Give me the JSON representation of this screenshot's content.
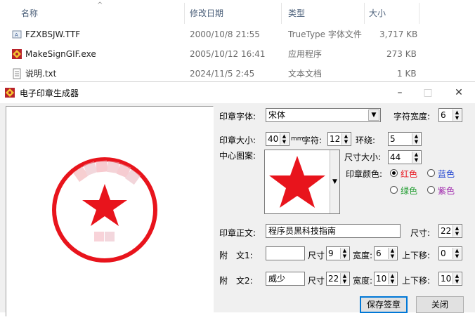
{
  "explorer": {
    "columns": {
      "name": "名称",
      "date": "修改日期",
      "type": "类型",
      "size": "大小"
    },
    "files": [
      {
        "name": "FZXBSJW.TTF",
        "date": "2000/10/8 21:55",
        "type": "TrueType 字体文件",
        "size": "3,717 KB",
        "icon": "font-file-icon"
      },
      {
        "name": "MakeSignGIF.exe",
        "date": "2005/10/12 16:41",
        "type": "应用程序",
        "size": "273 KB",
        "icon": "app-exe-icon"
      },
      {
        "name": "说明.txt",
        "date": "2024/11/5 2:45",
        "type": "文本文档",
        "size": "1 KB",
        "icon": "text-file-icon"
      }
    ]
  },
  "dialog": {
    "title": "电子印章生成器",
    "font_label": "印章字体:",
    "font_value": "宋体",
    "char_width_label": "字符宽度:",
    "char_width_value": "6",
    "size_label": "印章大小:",
    "size_value": "40",
    "mm_unit": "mm",
    "char_label": "字符:",
    "char_value": "12",
    "ring_label": "环绕:",
    "ring_value": "5",
    "center_label": "中心图案:",
    "center_size_label": "尺寸大小:",
    "center_size_value": "44",
    "color_label": "印章颜色:",
    "colors": {
      "red": "红色",
      "blue": "蓝色",
      "green": "绿色",
      "purple": "紫色"
    },
    "body_label": "印章正文:",
    "body_value": "程序员黑科技指南",
    "body_size_label": "尺寸:",
    "body_size_value": "22",
    "aux1_label": "附　文1:",
    "aux1_value": "",
    "aux1_size_label": "尺寸",
    "aux1_size_value": "9",
    "aux1_width_label": "宽度:",
    "aux1_width_value": "6",
    "aux1_shift_label": "上下移:",
    "aux1_shift_value": "0",
    "aux2_label": "附　文2:",
    "aux2_value": "威少",
    "aux2_size_label": "尺寸",
    "aux2_size_value": "22",
    "aux2_width_label": "宽度:",
    "aux2_width_value": "10",
    "aux2_shift_label": "上下移:",
    "aux2_shift_value": "10",
    "save_label": "保存签章",
    "close_label": "关闭",
    "accent_red": "#e8141c",
    "selected_color": "red"
  }
}
